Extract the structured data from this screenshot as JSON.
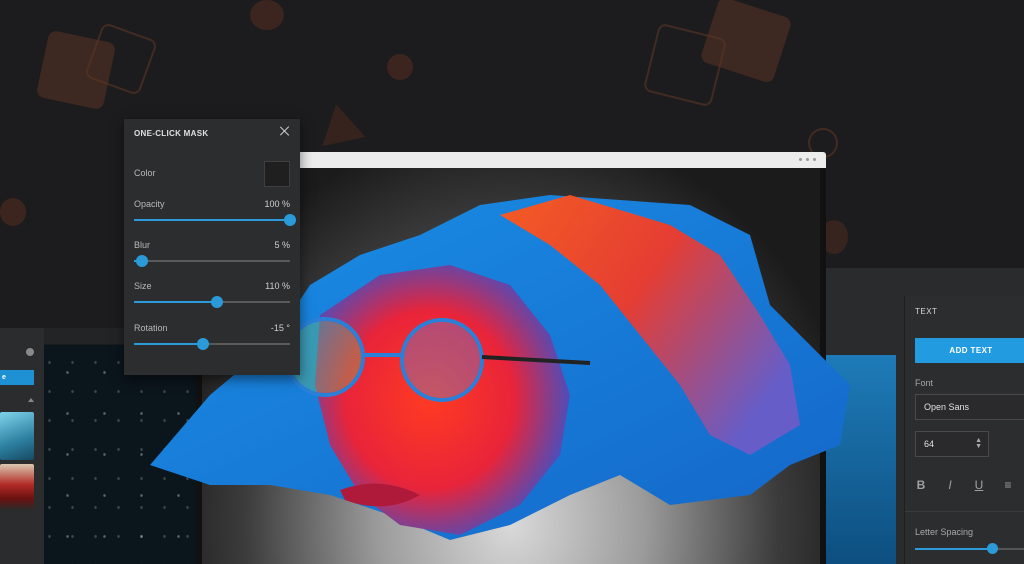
{
  "mask_panel": {
    "title": "ONE-CLICK MASK",
    "color_label": "Color",
    "sliders": [
      {
        "label": "Opacity",
        "value": "100 %",
        "level": 1.0
      },
      {
        "label": "Blur",
        "value": "5 %",
        "level": 0.05
      },
      {
        "label": "Size",
        "value": "110 %",
        "level": 0.53
      },
      {
        "label": "Rotation",
        "value": "-15 °",
        "level": 0.44
      }
    ]
  },
  "text_panel": {
    "title": "TEXT",
    "add_text_label": "ADD TEXT",
    "font_label": "Font",
    "font_value": "Open Sans",
    "size_value": "64",
    "format_buttons": [
      "B",
      "I",
      "U",
      "≡"
    ],
    "letter_spacing_label": "Letter Spacing",
    "letter_spacing_level": 0.69
  },
  "left_panel": {
    "button_label": "e"
  },
  "colors": {
    "accent": "#239be0",
    "panel": "#2c2d2f",
    "background": "#1c1c1e"
  }
}
